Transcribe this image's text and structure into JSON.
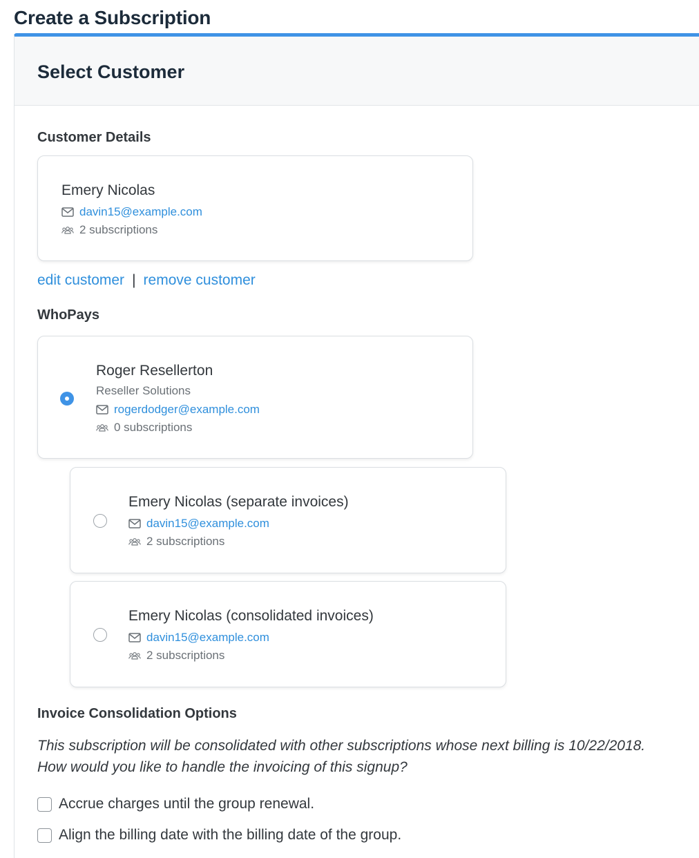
{
  "page": {
    "title": "Create a Subscription"
  },
  "panel": {
    "title": "Select Customer"
  },
  "customer_details": {
    "heading": "Customer Details",
    "name": "Emery Nicolas",
    "email": "davin15@example.com",
    "subscriptions": "2 subscriptions"
  },
  "customer_actions": {
    "edit": "edit customer",
    "separator": "|",
    "remove": "remove customer"
  },
  "who_pays": {
    "heading": "WhoPays",
    "options": [
      {
        "name": "Roger Resellerton",
        "company": "Reseller Solutions",
        "email": "rogerdodger@example.com",
        "subscriptions": "0 subscriptions",
        "selected": true
      },
      {
        "name": "Emery Nicolas (separate invoices)",
        "email": "davin15@example.com",
        "subscriptions": "2 subscriptions",
        "selected": false
      },
      {
        "name": "Emery Nicolas (consolidated invoices)",
        "email": "davin15@example.com",
        "subscriptions": "2 subscriptions",
        "selected": false
      }
    ]
  },
  "invoice_consolidation": {
    "heading": "Invoice Consolidation Options",
    "description_line1": "This subscription will be consolidated with other subscriptions whose next billing is 10/22/2018.",
    "description_line2": "How would you like to handle the invoicing of this signup?",
    "options": [
      {
        "label": "Accrue charges until the group renewal.",
        "checked": false
      },
      {
        "label": "Align the billing date with the billing date of the group.",
        "checked": false
      }
    ]
  },
  "icons": {
    "email": "envelope-icon",
    "subscriptions": "users-icon"
  },
  "colors": {
    "accent": "#3f93e6",
    "link": "#2f8fdc"
  }
}
